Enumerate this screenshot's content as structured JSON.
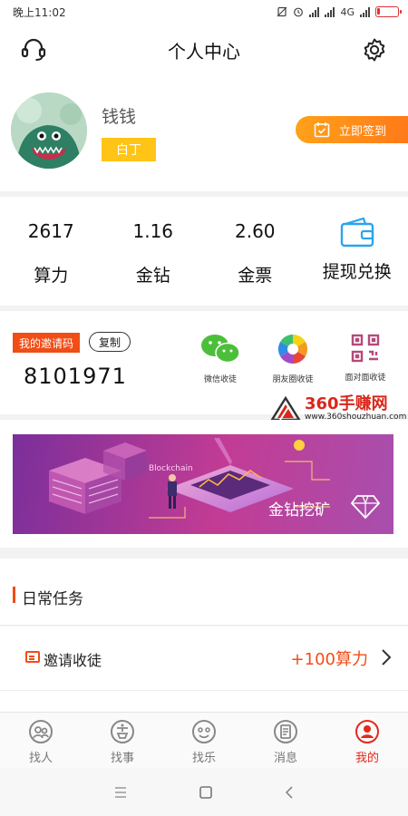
{
  "status_bar": {
    "time": "晚上11:02",
    "network": "4G"
  },
  "header": {
    "title": "个人中心",
    "left_icon": "customer-service-icon",
    "right_icon": "gear-icon"
  },
  "profile": {
    "username": "钱钱",
    "level": "白丁",
    "signin_label": "立即签到"
  },
  "stats": [
    {
      "value": "2617",
      "label": "算力"
    },
    {
      "value": "1.16",
      "label": "金钻"
    },
    {
      "value": "2.60",
      "label": "金票"
    },
    {
      "icon": "wallet-icon",
      "label": "提现兑换"
    }
  ],
  "invite": {
    "tag": "我的邀请码",
    "copy_label": "复制",
    "code": "8101971",
    "share": [
      {
        "icon": "wechat-icon",
        "label": "微信收徒"
      },
      {
        "icon": "moments-icon",
        "label": "朋友圈收徒"
      },
      {
        "icon": "qrcode-icon",
        "label": "面对面收徒"
      }
    ],
    "watermark": {
      "title": "360手赚网",
      "url": "www.360shouzhuan.com"
    }
  },
  "banner": {
    "title": "金钻挖矿",
    "scene_text": "Blockchain"
  },
  "daily_tasks": {
    "title": "日常任务",
    "items": [
      {
        "name": "邀请收徒",
        "reward": "+100算力"
      }
    ]
  },
  "tabbar": [
    {
      "label": "找人",
      "icon": "people-icon"
    },
    {
      "label": "找事",
      "icon": "task-icon"
    },
    {
      "label": "找乐",
      "icon": "smile-icon"
    },
    {
      "label": "消息",
      "icon": "message-icon"
    },
    {
      "label": "我的",
      "icon": "user-icon",
      "active": true
    }
  ],
  "colors": {
    "accent": "#f04d17",
    "gold": "#ffc415",
    "active_tab": "#e4291b",
    "signin": "#ff8a18"
  }
}
